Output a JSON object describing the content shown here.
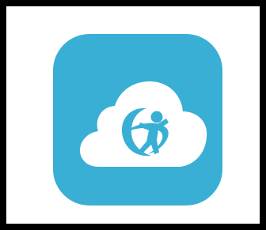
{
  "app_icon": {
    "icon": "cloud-with-person-and-orbit-logo",
    "colors": {
      "background": "#3AAFD5",
      "cloud": "#FFFFFF",
      "logo": "#3AAFD5"
    }
  }
}
